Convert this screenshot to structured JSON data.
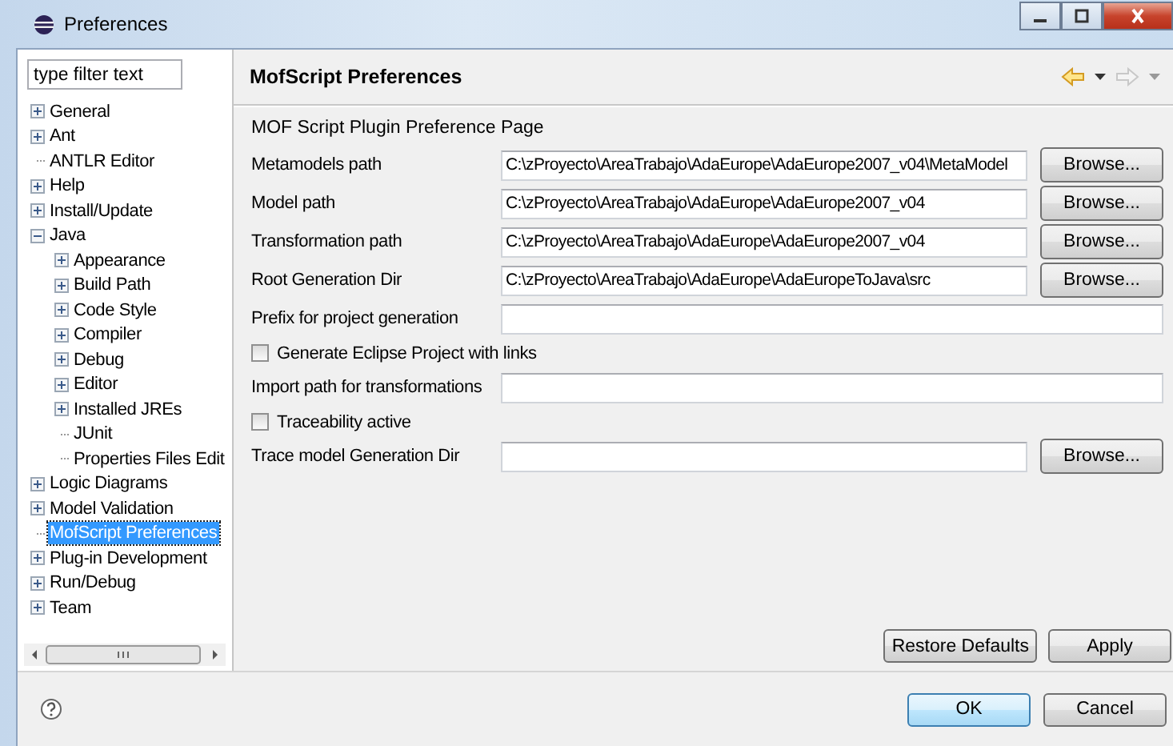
{
  "window": {
    "title": "Preferences"
  },
  "filter": {
    "value": "type filter text"
  },
  "tree": [
    {
      "label": "General",
      "kind": "collapsed",
      "selected": false
    },
    {
      "label": "Ant",
      "kind": "collapsed",
      "selected": false
    },
    {
      "label": "ANTLR Editor",
      "kind": "leaf",
      "selected": false
    },
    {
      "label": "Help",
      "kind": "collapsed",
      "selected": false
    },
    {
      "label": "Install/Update",
      "kind": "collapsed",
      "selected": false
    },
    {
      "label": "Java",
      "kind": "expanded",
      "selected": false,
      "children": [
        {
          "label": "Appearance",
          "kind": "collapsed",
          "selected": false
        },
        {
          "label": "Build Path",
          "kind": "collapsed",
          "selected": false
        },
        {
          "label": "Code Style",
          "kind": "collapsed",
          "selected": false
        },
        {
          "label": "Compiler",
          "kind": "collapsed",
          "selected": false
        },
        {
          "label": "Debug",
          "kind": "collapsed",
          "selected": false
        },
        {
          "label": "Editor",
          "kind": "collapsed",
          "selected": false
        },
        {
          "label": "Installed JREs",
          "kind": "collapsed",
          "selected": false
        },
        {
          "label": "JUnit",
          "kind": "leaf",
          "selected": false
        },
        {
          "label": "Properties Files Edit",
          "kind": "leaf",
          "selected": false
        }
      ]
    },
    {
      "label": "Logic Diagrams",
      "kind": "collapsed",
      "selected": false
    },
    {
      "label": "Model Validation",
      "kind": "collapsed",
      "selected": false
    },
    {
      "label": "MofScript Preferences",
      "kind": "leaf",
      "selected": true
    },
    {
      "label": "Plug-in Development",
      "kind": "collapsed",
      "selected": false
    },
    {
      "label": "Run/Debug",
      "kind": "collapsed",
      "selected": false
    },
    {
      "label": "Team",
      "kind": "collapsed",
      "selected": false
    }
  ],
  "page": {
    "title": "MofScript Preferences",
    "back": {
      "disabled": false
    },
    "forward": {
      "disabled": true
    },
    "description": "MOF Script Plugin Preference Page"
  },
  "fields": [
    {
      "kind": "path",
      "label": "Metamodels path",
      "value": "C:\\zProyecto\\AreaTrabajo\\AdaEurope\\AdaEurope2007_v04\\MetaModel",
      "button": "Browse..."
    },
    {
      "kind": "path",
      "label": "Model path",
      "value": "C:\\zProyecto\\AreaTrabajo\\AdaEurope\\AdaEurope2007_v04",
      "button": "Browse..."
    },
    {
      "kind": "path",
      "label": "Transformation path",
      "value": "C:\\zProyecto\\AreaTrabajo\\AdaEurope\\AdaEurope2007_v04",
      "button": "Browse..."
    },
    {
      "kind": "path",
      "label": "Root Generation Dir",
      "value": "C:\\zProyecto\\AreaTrabajo\\AdaEurope\\AdaEuropeToJava\\src",
      "button": "Browse..."
    },
    {
      "kind": "text",
      "label": "Prefix for project generation"
    },
    {
      "kind": "checkbox",
      "label": "Generate Eclipse Project with links",
      "checked": false
    },
    {
      "kind": "text",
      "label": "Import path for transformations"
    },
    {
      "kind": "checkbox",
      "label": "Traceability active",
      "checked": false
    },
    {
      "kind": "path",
      "label": "Trace model Generation Dir",
      "button": "Browse..."
    }
  ],
  "page_buttons": [
    "Restore Defaults",
    "Apply"
  ],
  "dialog_buttons": [
    {
      "label": "OK",
      "default": true
    },
    {
      "label": "Cancel",
      "default": false
    }
  ]
}
